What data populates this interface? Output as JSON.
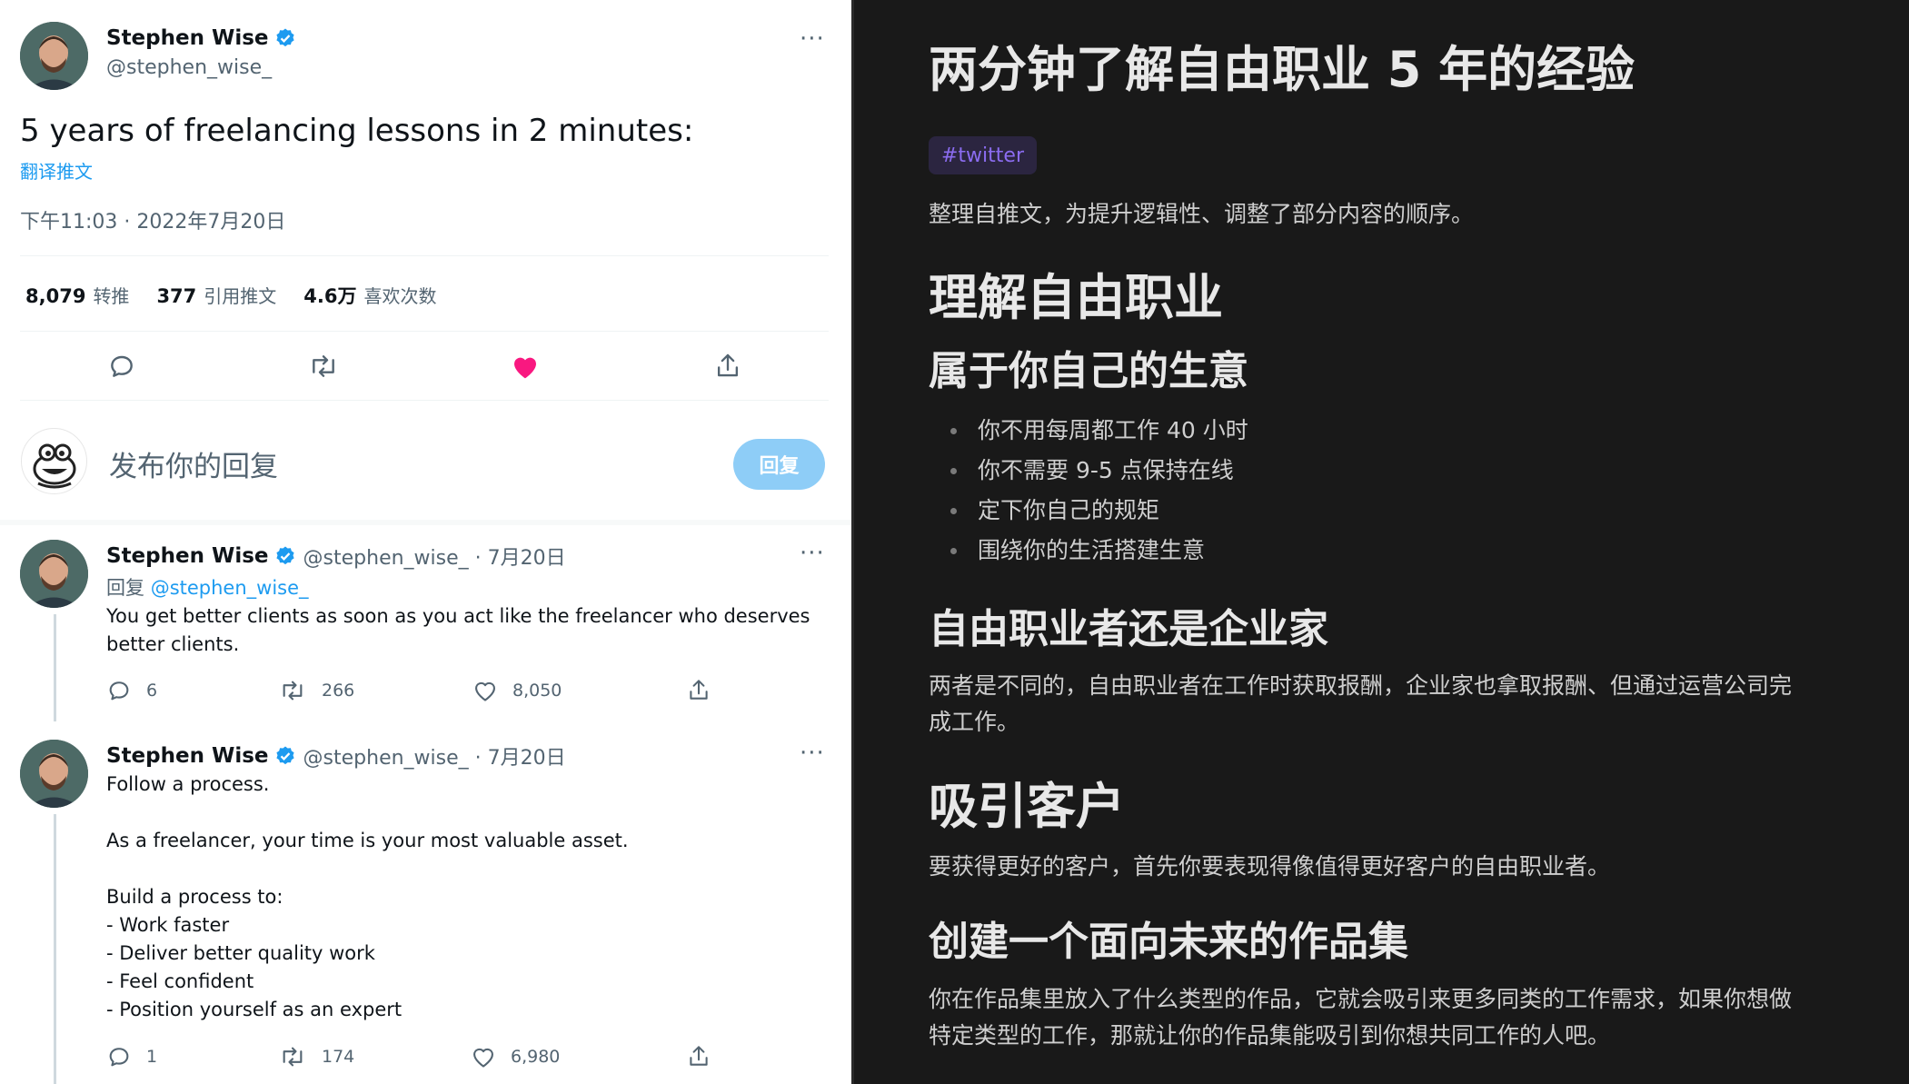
{
  "tweet": {
    "author_name": "Stephen Wise",
    "author_handle": "@stephen_wise_",
    "text": "5 years of freelancing lessons in 2 minutes:",
    "translate_link": "翻译推文",
    "timestamp": "下午11:03 · 2022年7月20日",
    "stats": [
      {
        "value": "8,079",
        "label": "转推"
      },
      {
        "value": "377",
        "label": "引用推文"
      },
      {
        "value": "4.6万",
        "label": "喜欢次数"
      }
    ],
    "liked": true
  },
  "reply_composer": {
    "placeholder": "发布你的回复",
    "button_label": "回复"
  },
  "replies": [
    {
      "author_name": "Stephen Wise",
      "meta": "@stephen_wise_ · 7月20日",
      "reply_to_prefix": "回复",
      "reply_to_handle": "@stephen_wise_",
      "text": "You get better clients as soon as you act like the freelancer who deserves better clients.",
      "reply_count": "6",
      "retweet_count": "266",
      "like_count": "8,050"
    },
    {
      "author_name": "Stephen Wise",
      "meta": "@stephen_wise_ · 7月20日",
      "text": "Follow a process.\n\nAs a freelancer, your time is your most valuable asset.\n\nBuild a process to:\n- Work faster\n- Deliver better quality work\n- Feel confident\n- Position yourself as an expert",
      "reply_count": "1",
      "retweet_count": "174",
      "like_count": "6,980"
    }
  ],
  "notes": {
    "title": "两分钟了解自由职业 5 年的经验",
    "tag": "#twitter",
    "intro": "整理自推文，为提升逻辑性、调整了部分内容的顺序。",
    "section1_heading": "理解自由职业",
    "section1_sub": "属于你自己的生意",
    "section1_list": [
      "你不用每周都工作 40 小时",
      "你不需要 9-5 点保持在线",
      "定下你自己的规矩",
      "围绕你的生活搭建生意"
    ],
    "section1b_heading": "自由职业者还是企业家",
    "section1b_text_line1": "两者是不同的，自由职业者在工作时获取报酬，企业家也拿取报酬、但通过运营公司完",
    "section1b_text_line2": "成工作。",
    "section2_heading": "吸引客户",
    "section2_text": "要获得更好的客户，首先你要表现得像值得更好客户的自由职业者。",
    "section2b_heading": "创建一个面向未来的作品集",
    "section2b_text_line1": "你在作品集里放入了什么类型的作品，它就会吸引来更多同类的工作需求，如果你想做",
    "section2b_text_line2": "特定类型的工作，那就让你的作品集能吸引到你想共同工作的人吧。"
  },
  "colors": {
    "accent": "#1d9bf0",
    "like": "#f91880",
    "dark_bg": "#191919",
    "tag_text": "#8b6cf0"
  }
}
